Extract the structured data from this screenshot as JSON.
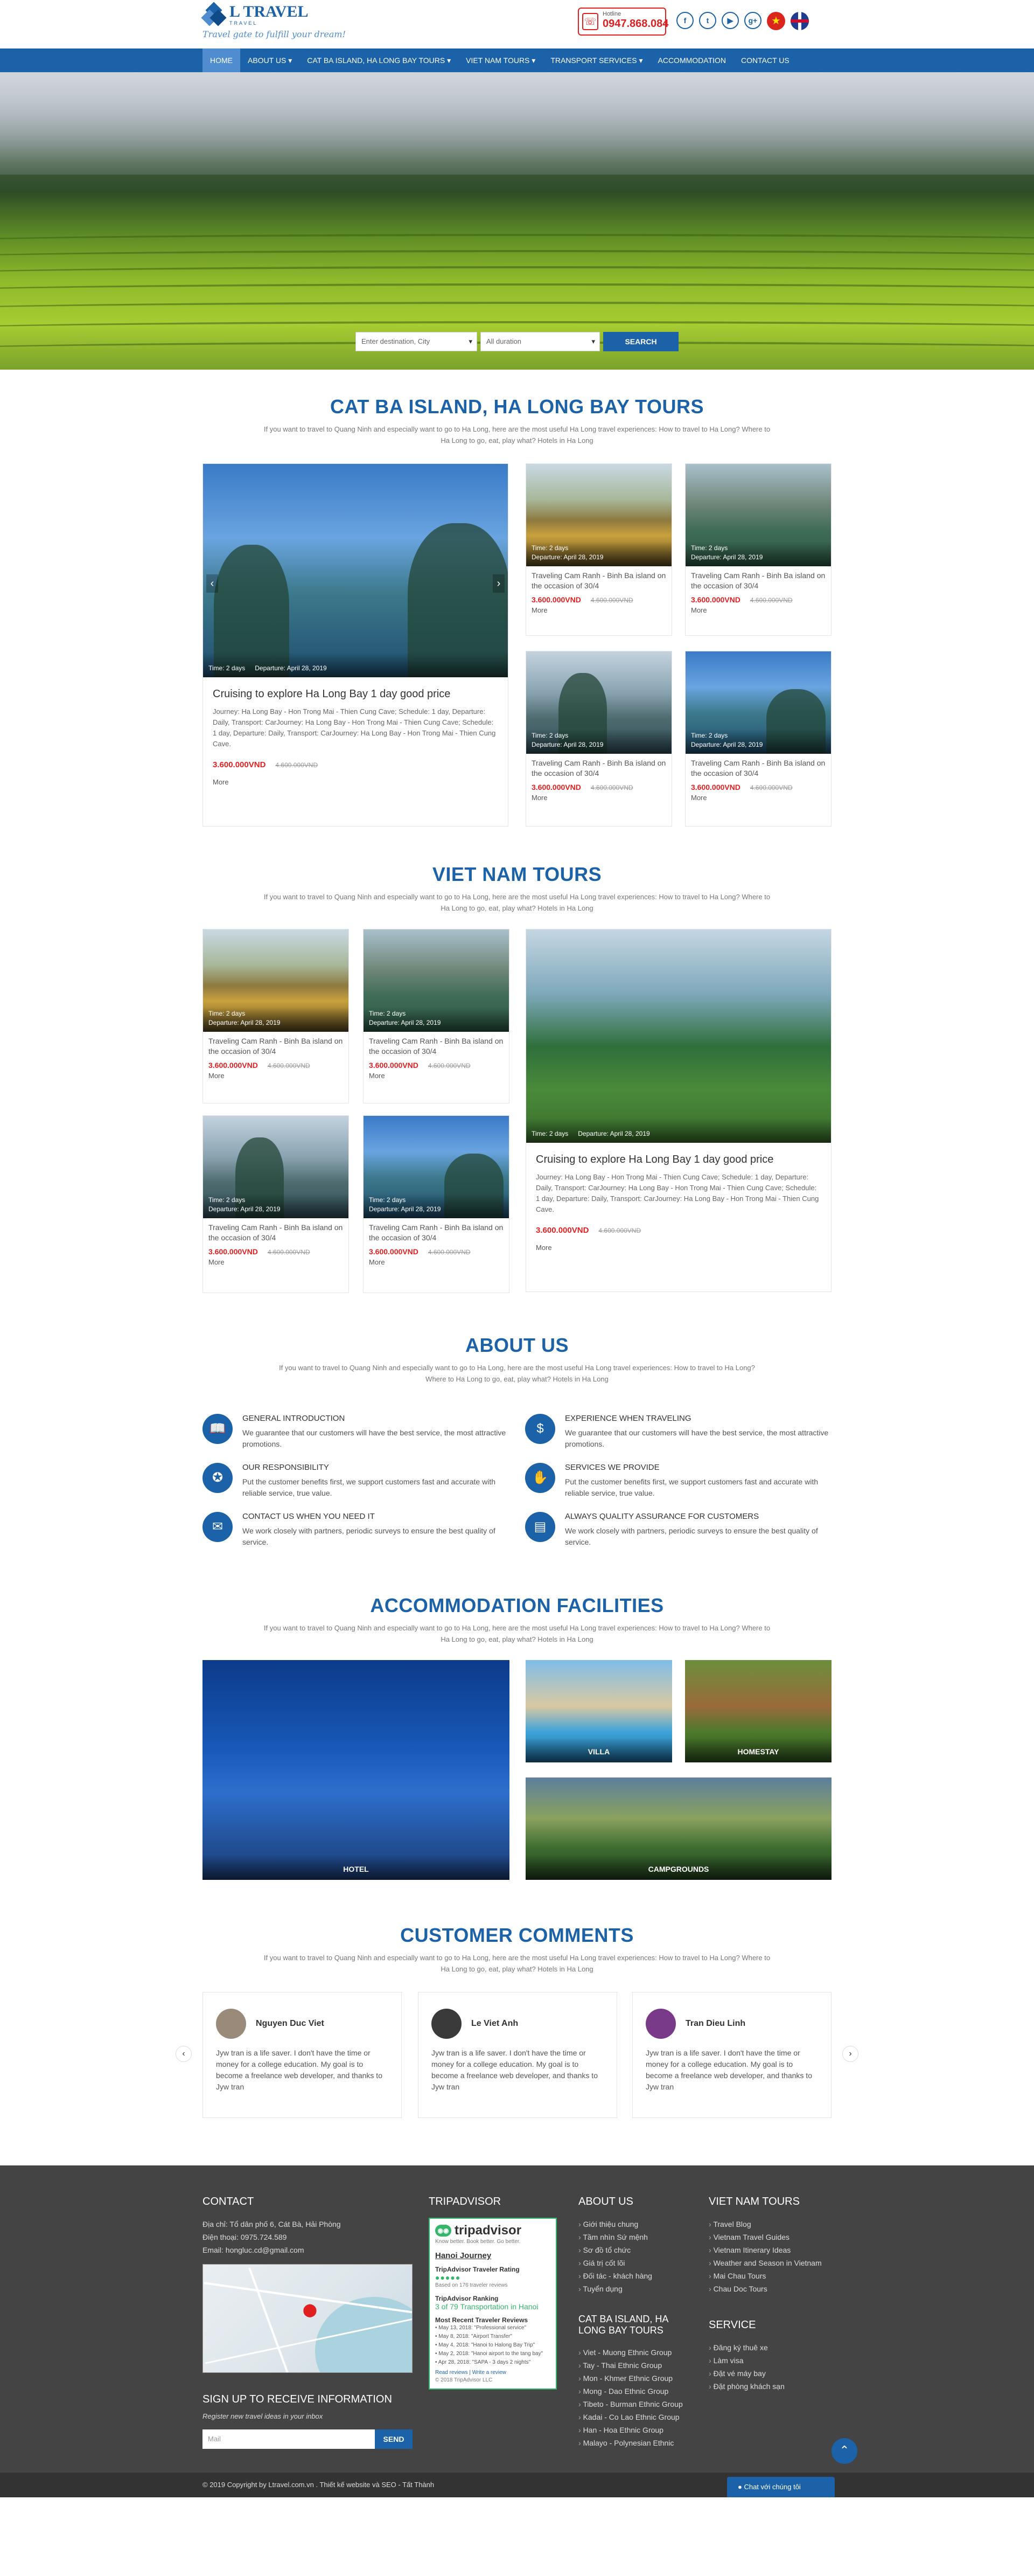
{
  "brand": {
    "logo_name": "L TRAVEL",
    "logo_sub": "TRAVEL",
    "slogan": "Travel gate to fulfill your dream!",
    "accent": "#1b62a8"
  },
  "hotline": {
    "title": "Hotline",
    "number": "0947.868.084",
    "color": "#e02020"
  },
  "social": {
    "facebook": "f",
    "twitter": "t",
    "youtube": "▶",
    "google": "g+"
  },
  "nav": {
    "items": [
      {
        "label": "HOME"
      },
      {
        "label": "ABOUT US ▾"
      },
      {
        "label": "CAT BA ISLAND, HA LONG BAY TOURS ▾"
      },
      {
        "label": "VIET NAM TOURS ▾"
      },
      {
        "label": "TRANSPORT SERVICES ▾"
      },
      {
        "label": "ACCOMMODATION"
      },
      {
        "label": "CONTACT US"
      }
    ]
  },
  "search": {
    "destination": "Enter destination, City",
    "duration": "All duration",
    "button": "SEARCH"
  },
  "intro": "If you want to travel to Quang Ninh and especially want to go to Ha Long, here are the most useful Ha Long travel experiences: How to travel to Ha Long? Where to Ha Long to go, eat, play what? Hotels in Ha Long",
  "catba": {
    "title": "CAT BA ISLAND, HA LONG BAY TOURS",
    "featured": {
      "time": "Time: 2 days",
      "departure": "Departure: April 28, 2019",
      "title": "Cruising to explore Ha Long Bay 1 day good price",
      "desc": "Journey: Ha Long Bay - Hon Trong Mai - Thien Cung Cave; Schedule: 1 day, Departure: Daily, Transport: CarJourney: Ha Long Bay - Hon Trong Mai - Thien Cung Cave; Schedule: 1 day, Departure: Daily, Transport: CarJourney: Ha Long Bay - Hon Trong Mai - Thien Cung Cave.",
      "price": "3.600.000VND",
      "old_price": "4.600.000VND",
      "more": "More"
    },
    "cards": [
      {
        "time": "Time: 2 days",
        "departure": "Departure: April 28, 2019",
        "title": "Traveling Cam Ranh - Binh Ba island on the occasion of 30/4",
        "price": "3.600.000VND",
        "old_price": "4.600.000VND",
        "more": "More"
      },
      {
        "time": "Time: 2 days",
        "departure": "Departure: April 28, 2019",
        "title": "Traveling Cam Ranh - Binh Ba island on the occasion of 30/4",
        "price": "3.600.000VND",
        "old_price": "4.600.000VND",
        "more": "More"
      },
      {
        "time": "Time: 2 days",
        "departure": "Departure: April 28, 2019",
        "title": "Traveling Cam Ranh - Binh Ba island on the occasion of 30/4",
        "price": "3.600.000VND",
        "old_price": "4.600.000VND",
        "more": "More"
      },
      {
        "time": "Time: 2 days",
        "departure": "Departure: April 28, 2019",
        "title": "Traveling Cam Ranh - Binh Ba island on the occasion of 30/4",
        "price": "3.600.000VND",
        "old_price": "4.600.000VND",
        "more": "More"
      }
    ]
  },
  "vietnam": {
    "title": "VIET NAM TOURS",
    "featured": {
      "time": "Time: 2 days",
      "departure": "Departure: April 28, 2019",
      "title": "Cruising to explore Ha Long Bay 1 day good price",
      "desc": "Journey: Ha Long Bay - Hon Trong Mai - Thien Cung Cave; Schedule: 1 day, Departure: Daily, Transport: CarJourney: Ha Long Bay - Hon Trong Mai - Thien Cung Cave; Schedule: 1 day, Departure: Daily, Transport: CarJourney: Ha Long Bay - Hon Trong Mai - Thien Cung Cave.",
      "price": "3.600.000VND",
      "old_price": "4.600.000VND",
      "more": "More"
    },
    "cards": [
      {
        "time": "Time: 2 days",
        "departure": "Departure: April 28, 2019",
        "title": "Traveling Cam Ranh - Binh Ba island on the occasion of 30/4",
        "price": "3.600.000VND",
        "old_price": "4.600.000VND",
        "more": "More"
      },
      {
        "time": "Time: 2 days",
        "departure": "Departure: April 28, 2019",
        "title": "Traveling Cam Ranh - Binh Ba island on the occasion of 30/4",
        "price": "3.600.000VND",
        "old_price": "4.600.000VND",
        "more": "More"
      },
      {
        "time": "Time: 2 days",
        "departure": "Departure: April 28, 2019",
        "title": "Traveling Cam Ranh - Binh Ba island on the occasion of 30/4",
        "price": "3.600.000VND",
        "old_price": "4.600.000VND",
        "more": "More"
      },
      {
        "time": "Time: 2 days",
        "departure": "Departure: April 28, 2019",
        "title": "Traveling Cam Ranh - Binh Ba island on the occasion of 30/4",
        "price": "3.600.000VND",
        "old_price": "4.600.000VND",
        "more": "More"
      }
    ]
  },
  "about": {
    "title": "ABOUT US",
    "items": [
      {
        "title": "GENERAL INTRODUCTION",
        "text": "We guarantee that our customers will have the best service, the most attractive promotions.",
        "icon": "book-icon"
      },
      {
        "title": "EXPERIENCE WHEN TRAVELING",
        "text": "We guarantee that our customers will have the best service, the most attractive promotions.",
        "icon": "dollar-icon"
      },
      {
        "title": "OUR RESPONSIBILITY",
        "text": "Put the customer benefits first, we support customers fast and accurate with reliable service, true value.",
        "icon": "award-icon"
      },
      {
        "title": "SERVICES WE PROVIDE",
        "text": "Put the customer benefits first, we support customers fast and accurate with reliable service, true value.",
        "icon": "handshake-icon"
      },
      {
        "title": "CONTACT US WHEN YOU NEED IT",
        "text": "We work closely with partners, periodic surveys to ensure the best quality of service.",
        "icon": "mail-icon"
      },
      {
        "title": "ALWAYS QUALITY ASSURANCE FOR CUSTOMERS",
        "text": "We work closely with partners, periodic surveys to ensure the best quality of service.",
        "icon": "document-icon"
      }
    ]
  },
  "accommodation": {
    "title": "ACCOMMODATION FACILITIES",
    "items": [
      {
        "label": "HOTEL"
      },
      {
        "label": "VILLA"
      },
      {
        "label": "HOMESTAY"
      },
      {
        "label": "CAMPGROUNDS"
      }
    ]
  },
  "comments": {
    "title": "CUSTOMER COMMENTS",
    "items": [
      {
        "name": "Nguyen Duc Viet",
        "text": "Jyw tran is a life saver. I don't have the time or money for a college education. My goal is to become a freelance web developer, and thanks to Jyw tran"
      },
      {
        "name": "Le Viet Anh",
        "text": "Jyw tran is a life saver. I don't have the time or money for a college education. My goal is to become a freelance web developer, and thanks to Jyw tran"
      },
      {
        "name": "Tran Dieu Linh",
        "text": "Jyw tran is a life saver. I don't have the time or money for a college education. My goal is to become a freelance web developer, and thanks to Jyw tran"
      }
    ]
  },
  "footer": {
    "contact_title": "CONTACT",
    "address": "Địa chỉ: Tổ dân phố 6, Cát Bà, Hải Phòng",
    "phone": "Điện thoại: 0975.724.589",
    "email": "Email: hongluc.cd@gmail.com",
    "newsletter_title": "SIGN UP TO RECEIVE INFORMATION",
    "newsletter_sub": "Register new travel ideas in your inbox",
    "newsletter_placeholder": "Mail",
    "newsletter_button": "SEND",
    "tripadvisor_title": "TRIPADVISOR",
    "tripadvisor": {
      "brand": "tripadvisor",
      "know_better": "Know better. Book better. Go better.",
      "place": "Hanoi Journey",
      "award": "TripAdvisor Traveler Rating",
      "rating": "●●●●●",
      "based": "Based on 176 traveler reviews",
      "ranking_title": "TripAdvisor Ranking",
      "ranking": "3 of 79 Transportation in Hanoi",
      "recent_title": "Most Recent Traveler Reviews",
      "reviews": [
        "May 13, 2018: \"Professional service\"",
        "May 8, 2018: \"Airport Transfer\"",
        "May 4, 2018: \"Hanoi to Halong Bay Trip\"",
        "May 2, 2018: \"Hanoi airport to the tang bay\"",
        "Apr 28, 2018: \"SAPA - 3 days 2 nights\""
      ],
      "links": "Read reviews | Write a review",
      "copyright": "© 2018 TripAdvisor LLC"
    },
    "about_title": "ABOUT US",
    "about_links": [
      "Giới thiệu chung",
      "Tầm nhìn Sứ mệnh",
      "Sơ đồ tổ chức",
      "Giá trị cốt lõi",
      "Đối tác - khách hàng",
      "Tuyển dụng"
    ],
    "catba_title": "CAT BA ISLAND, HA LONG BAY TOURS",
    "catba_links": [
      "Viet - Muong Ethnic Group",
      "Tay - Thai Ethnic Group",
      "Mon - Khmer Ethnic Group",
      "Mong - Dao Ethnic Group",
      "Tibeto - Burman Ethnic Group",
      "Kadai - Co Lao Ethnic Group",
      "Han - Hoa Ethnic Group",
      "Malayo - Polynesian Ethnic"
    ],
    "vn_title": "VIET NAM TOURS",
    "vn_links": [
      "Travel Blog",
      "Vietnam Travel Guides",
      "Vietnam Itinerary Ideas",
      "Weather and Season in Vietnam",
      "Mai Chau Tours",
      "Chau Doc Tours"
    ],
    "service_title": "SERVICE",
    "service_links": [
      "Đăng ký thuê xe",
      "Làm visa",
      "Đặt vé máy bay",
      "Đặt phòng khách sạn"
    ]
  },
  "copyright": "© 2019 Copyright by Ltravel.com.vn . Thiết kế website và SEO - Tất Thành",
  "chat": "● Chat với chúng tôi",
  "to_top": "⌃"
}
